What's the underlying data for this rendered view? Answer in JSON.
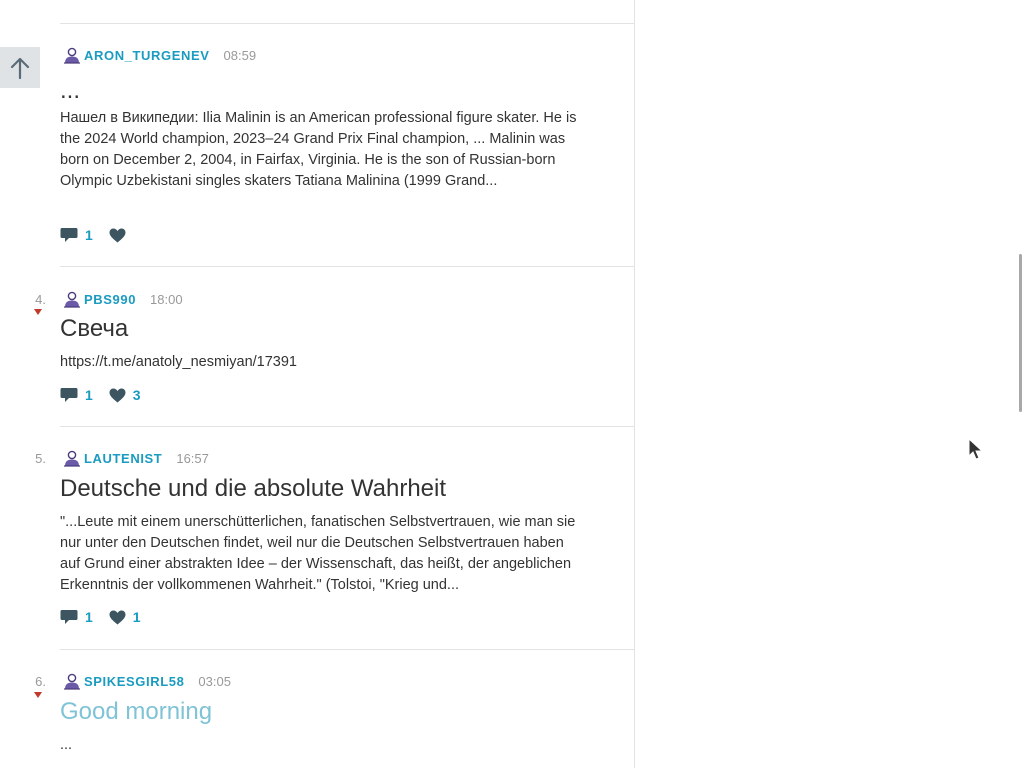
{
  "feed": {
    "posts": [
      {
        "rank": "",
        "username": "ARON_TURGENEV",
        "time": "08:59",
        "title": "...",
        "body": "Нашел в Википедии: Ilia Malinin is an American professional figure skater. He is the 2024 World champion, 2023–24 Grand Prix Final champion, ... Malinin was born on December 2, 2004, in Fairfax, Virginia. He is the son of Russian-born Olympic Uzbekistani singles skaters Tatiana Malinina (1999 Grand...",
        "comments": "1",
        "likes": ""
      },
      {
        "rank": "4.",
        "username": "PBS990",
        "time": "18:00",
        "title": "Свеча",
        "body": "https://t.me/anatoly_nesmiyan/17391",
        "comments": "1",
        "likes": "3"
      },
      {
        "rank": "5.",
        "username": "LAUTENIST",
        "time": "16:57",
        "title": "Deutsche und die absolute Wahrheit",
        "body": "\"...Leute mit einem unerschütterlichen, fanatischen Selbstvertrauen, wie man sie nur unter den Deutschen findet, weil nur die Deutschen Selbstvertrauen haben auf Grund einer abstrakten Idee – der Wissenschaft, das heißt, der angeblichen Erkenntnis der vollkommenen Wahrheit.\" (Tolstoi, \"Krieg und...",
        "comments": "1",
        "likes": "1"
      },
      {
        "rank": "6.",
        "username": "SPIKESGIRL58",
        "time": "03:05",
        "title": "Good morning",
        "body": "...",
        "comments": "",
        "likes": ""
      }
    ]
  },
  "icons": {
    "scroll_top": "arrow-up-icon",
    "user": "user-icon",
    "comment": "comment-icon",
    "like": "heart-icon"
  },
  "colors": {
    "accent": "#1a9bc0",
    "muted": "#999999",
    "downvote": "#c0392b"
  }
}
